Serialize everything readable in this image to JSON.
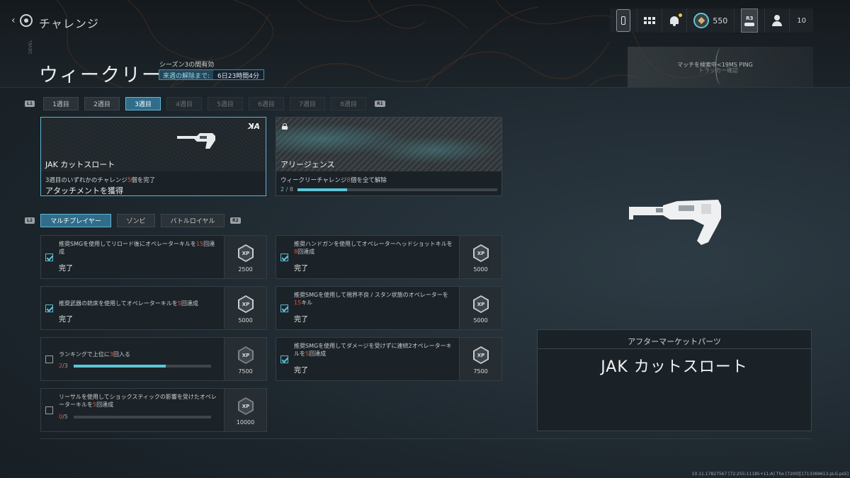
{
  "header": {
    "breadcrumb": "チャレンジ",
    "title": "ウィークリー",
    "side_label": "DEVEL",
    "season_note": "シーズン3の間有効",
    "unlock_label": "来週の解除まで:",
    "unlock_value": "6日23時間4分"
  },
  "hud": {
    "rank_value": "550",
    "r3_label": "R3",
    "party_count": "10"
  },
  "matchmaking": {
    "status": "マッチを検索中<19MS PING",
    "sub": "トラッカー確認"
  },
  "week_tabs": {
    "left_hint": "L1",
    "right_hint": "R1",
    "items": [
      "1週目",
      "2週目",
      "3週目",
      "4週目",
      "5週目",
      "6週目",
      "7週目",
      "8週目"
    ],
    "active_index": 2
  },
  "rewards": [
    {
      "name": "JAK カットスロート",
      "desc_pre": "3週目のいずれかのチャレンジ",
      "desc_num": "5",
      "desc_post": "個を完了",
      "sub": "アタッチメントを獲得",
      "brand": "ꓘA"
    },
    {
      "name": "アリージェンス",
      "desc_pre": "ウィークリーチャレンジ",
      "desc_num": "8",
      "desc_post": "個を全て解除",
      "progress_current": "2",
      "progress_sep": " / ",
      "progress_total": "8",
      "progress_fraction": 0.25
    }
  ],
  "mode_tabs": {
    "left_hint": "L2",
    "right_hint": "R2",
    "items": [
      "マルチプレイヤー",
      "ゾンビ",
      "バトルロイヤル"
    ],
    "active_index": 0
  },
  "challenges": [
    {
      "pre": "推奨SMGを使用してリロード後にオペレーターキルを",
      "num": "15",
      "post": "回達成",
      "status": "完了",
      "xp": "2500"
    },
    {
      "pre": "推奨ハンドガンを使用してオペレーターヘッドショットキルを",
      "num": "8",
      "post": "回達成",
      "status": "完了",
      "xp": "5000"
    },
    {
      "pre": "推奨武器の銃床を使用してオペレーターキルを",
      "num": "5",
      "post": "回達成",
      "status": "完了",
      "xp": "5000"
    },
    {
      "pre": "推奨SMGを使用して視界不良 / スタン状態のオペレーターを",
      "num": "15",
      "post": "キル",
      "status": "完了",
      "xp": "5000"
    },
    {
      "pre": "ランキングで上位に",
      "num": "3",
      "post": "回入る",
      "progress_current": "2",
      "progress_total": "/3",
      "progress_fraction": 0.67,
      "xp": "7500"
    },
    {
      "pre": "推奨SMGを使用してダメージを受けずに連続2オペレーターキルを",
      "num": "5",
      "post": "回達成",
      "status": "完了",
      "xp": "7500"
    },
    {
      "pre": "リーサルを使用してショックスティックの影響を受けたオペレーターキルを",
      "num": "5",
      "post": "回達成",
      "progress_current": "0",
      "progress_total": "/5",
      "progress_fraction": 0,
      "xp": "10000"
    }
  ],
  "detail": {
    "category": "アフターマーケットパーツ",
    "item_name": "JAK カットスロート"
  },
  "build_info": "10.11.17827567 [72:255:11185+11:A] Tho [7200][1713369613.pLG.ps5]",
  "colors": {
    "accent": "#5cc6d8",
    "highlight_number": "#e0513f",
    "active_tab": "#2f6d8a"
  }
}
